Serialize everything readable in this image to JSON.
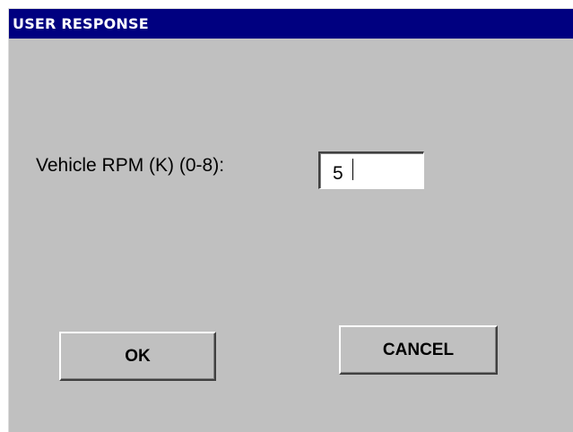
{
  "window": {
    "title": "USER RESPONSE",
    "title_bar_color": "#000080",
    "background_color": "#c0c0c0"
  },
  "form": {
    "rpm_label": "Vehicle RPM (K) (0-8):",
    "rpm_value": "5"
  },
  "buttons": {
    "ok_label": "OK",
    "cancel_label": "CANCEL"
  }
}
